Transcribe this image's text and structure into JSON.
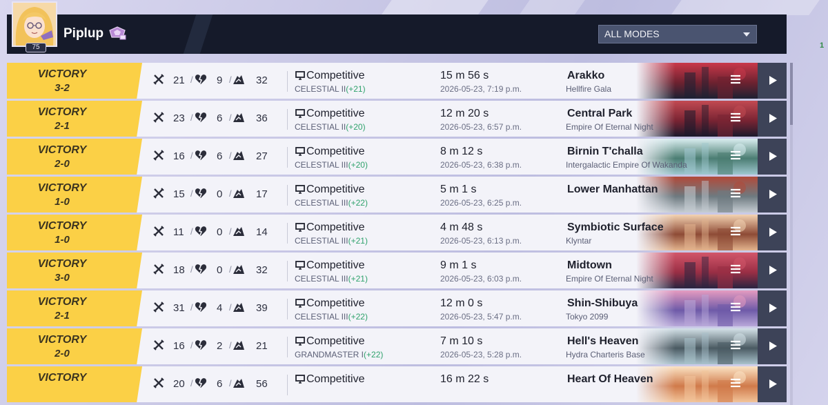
{
  "header": {
    "player_name": "Piplup",
    "level": "75",
    "mode_filter": "ALL MODES",
    "corner_text": "1"
  },
  "colors": {
    "victory": "#fbd046",
    "header_bg": "#151a2a",
    "rank_delta": "#2fa26c",
    "play_button": "#3d4358"
  },
  "matches": [
    {
      "result": "VICTORY",
      "score": "3-2",
      "kills": "21",
      "deaths": "9",
      "assists": "32",
      "mode": "Competitive",
      "rank": "CELESTIAL II",
      "delta": "(+21)",
      "duration": "15 m 56 s",
      "datetime": "2026-05-23, 7:19 p.m.",
      "map": "Arakko",
      "map_sub": "Hellfire Gala",
      "thumb": [
        "#1d2133",
        "#6e2230",
        "#c9384a"
      ]
    },
    {
      "result": "VICTORY",
      "score": "2-1",
      "kills": "23",
      "deaths": "6",
      "assists": "36",
      "mode": "Competitive",
      "rank": "CELESTIAL II",
      "delta": "(+20)",
      "duration": "12 m 20 s",
      "datetime": "2026-05-23, 6:57 p.m.",
      "map": "Central Park",
      "map_sub": "Empire Of Eternal Night",
      "thumb": [
        "#1c1a2c",
        "#7a2433",
        "#c24a52"
      ]
    },
    {
      "result": "VICTORY",
      "score": "2-0",
      "kills": "16",
      "deaths": "6",
      "assists": "27",
      "mode": "Competitive",
      "rank": "CELESTIAL III",
      "delta": "(+20)",
      "duration": "8 m 12 s",
      "datetime": "2026-05-23, 6:38 p.m.",
      "map": "Birnin T'challa",
      "map_sub": "Intergalactic Empire Of Wakanda",
      "thumb": [
        "#9ec7cf",
        "#4b7d72",
        "#d9eef0"
      ]
    },
    {
      "result": "VICTORY",
      "score": "1-0",
      "kills": "15",
      "deaths": "0",
      "assists": "17",
      "mode": "Competitive",
      "rank": "CELESTIAL III",
      "delta": "(+22)",
      "duration": "5 m 1 s",
      "datetime": "2026-05-23, 6:25 p.m.",
      "map": "Lower Manhattan",
      "map_sub": "",
      "thumb": [
        "#c6cdd3",
        "#6e7a80",
        "#b14a3a"
      ]
    },
    {
      "result": "VICTORY",
      "score": "1-0",
      "kills": "11",
      "deaths": "0",
      "assists": "14",
      "mode": "Competitive",
      "rank": "CELESTIAL III",
      "delta": "(+21)",
      "duration": "4 m 48 s",
      "datetime": "2026-05-23, 6:13 p.m.",
      "map": "Symbiotic Surface",
      "map_sub": "Klyntar",
      "thumb": [
        "#e3b48e",
        "#8e4b36",
        "#f3d3b2"
      ]
    },
    {
      "result": "VICTORY",
      "score": "3-0",
      "kills": "18",
      "deaths": "0",
      "assists": "32",
      "mode": "Competitive",
      "rank": "CELESTIAL III",
      "delta": "(+21)",
      "duration": "9 m 1 s",
      "datetime": "2026-05-23, 6:03 p.m.",
      "map": "Midtown",
      "map_sub": "Empire Of Eternal Night",
      "thumb": [
        "#2a2440",
        "#9a2f45",
        "#d2566a"
      ]
    },
    {
      "result": "VICTORY",
      "score": "2-1",
      "kills": "31",
      "deaths": "4",
      "assists": "39",
      "mode": "Competitive",
      "rank": "CELESTIAL III",
      "delta": "(+22)",
      "duration": "12 m 0 s",
      "datetime": "2026-05-23, 5:47 p.m.",
      "map": "Shin-Shibuya",
      "map_sub": "Tokyo 2099",
      "thumb": [
        "#b9a8d9",
        "#6e5aa8",
        "#e59bc0"
      ]
    },
    {
      "result": "VICTORY",
      "score": "2-0",
      "kills": "16",
      "deaths": "2",
      "assists": "21",
      "mode": "Competitive",
      "rank": "GRANDMASTER I",
      "delta": "(+22)",
      "duration": "7 m 10 s",
      "datetime": "2026-05-23, 5:28 p.m.",
      "map": "Hell's Heaven",
      "map_sub": "Hydra Charteris Base",
      "thumb": [
        "#a9c2cc",
        "#4a5a62",
        "#d4e2e8"
      ]
    },
    {
      "result": "VICTORY",
      "score": "",
      "kills": "20",
      "deaths": "6",
      "assists": "56",
      "mode": "Competitive",
      "rank": "",
      "delta": "",
      "duration": "16 m 22 s",
      "datetime": "",
      "map": "Heart Of Heaven",
      "map_sub": "",
      "thumb": [
        "#f2c49a",
        "#d07a4a",
        "#fbe3c4"
      ]
    }
  ]
}
